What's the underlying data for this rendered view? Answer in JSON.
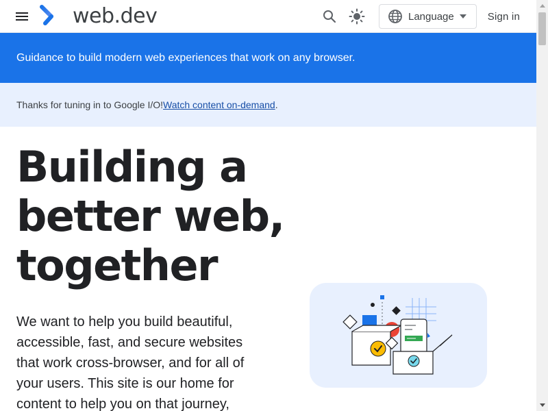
{
  "header": {
    "menu_icon": "hamburger-menu-icon",
    "logo_icon": "web-dev-chevron-logo",
    "site_name": "web.dev",
    "search_icon": "search-icon",
    "theme_icon": "brightness-icon",
    "language": {
      "icon": "globe-icon",
      "label": "Language",
      "dropdown_icon": "caret-down-icon"
    },
    "sign_in_label": "Sign in"
  },
  "banner": {
    "text": "Guidance to build modern web experiences that work on any browser."
  },
  "announcement": {
    "text": "Thanks for tuning in to Google I/O! ",
    "link_text": "Watch content on-demand",
    "trailing": "."
  },
  "hero": {
    "title_line1": "Building a",
    "title_line2": "better web,",
    "title_line3": "together",
    "body": "We want to help you build beautiful, accessible, fast, and secure websites that work cross-browser, and for all of your users. This site is our home for content to help you on that journey,"
  },
  "illustration": {
    "name": "boxes-with-checkmarks-illustration"
  },
  "colors": {
    "brand_blue": "#1a73e8",
    "announcement_bg": "#e8f0fe",
    "text_dark": "#202124",
    "link": "#174ea6"
  }
}
